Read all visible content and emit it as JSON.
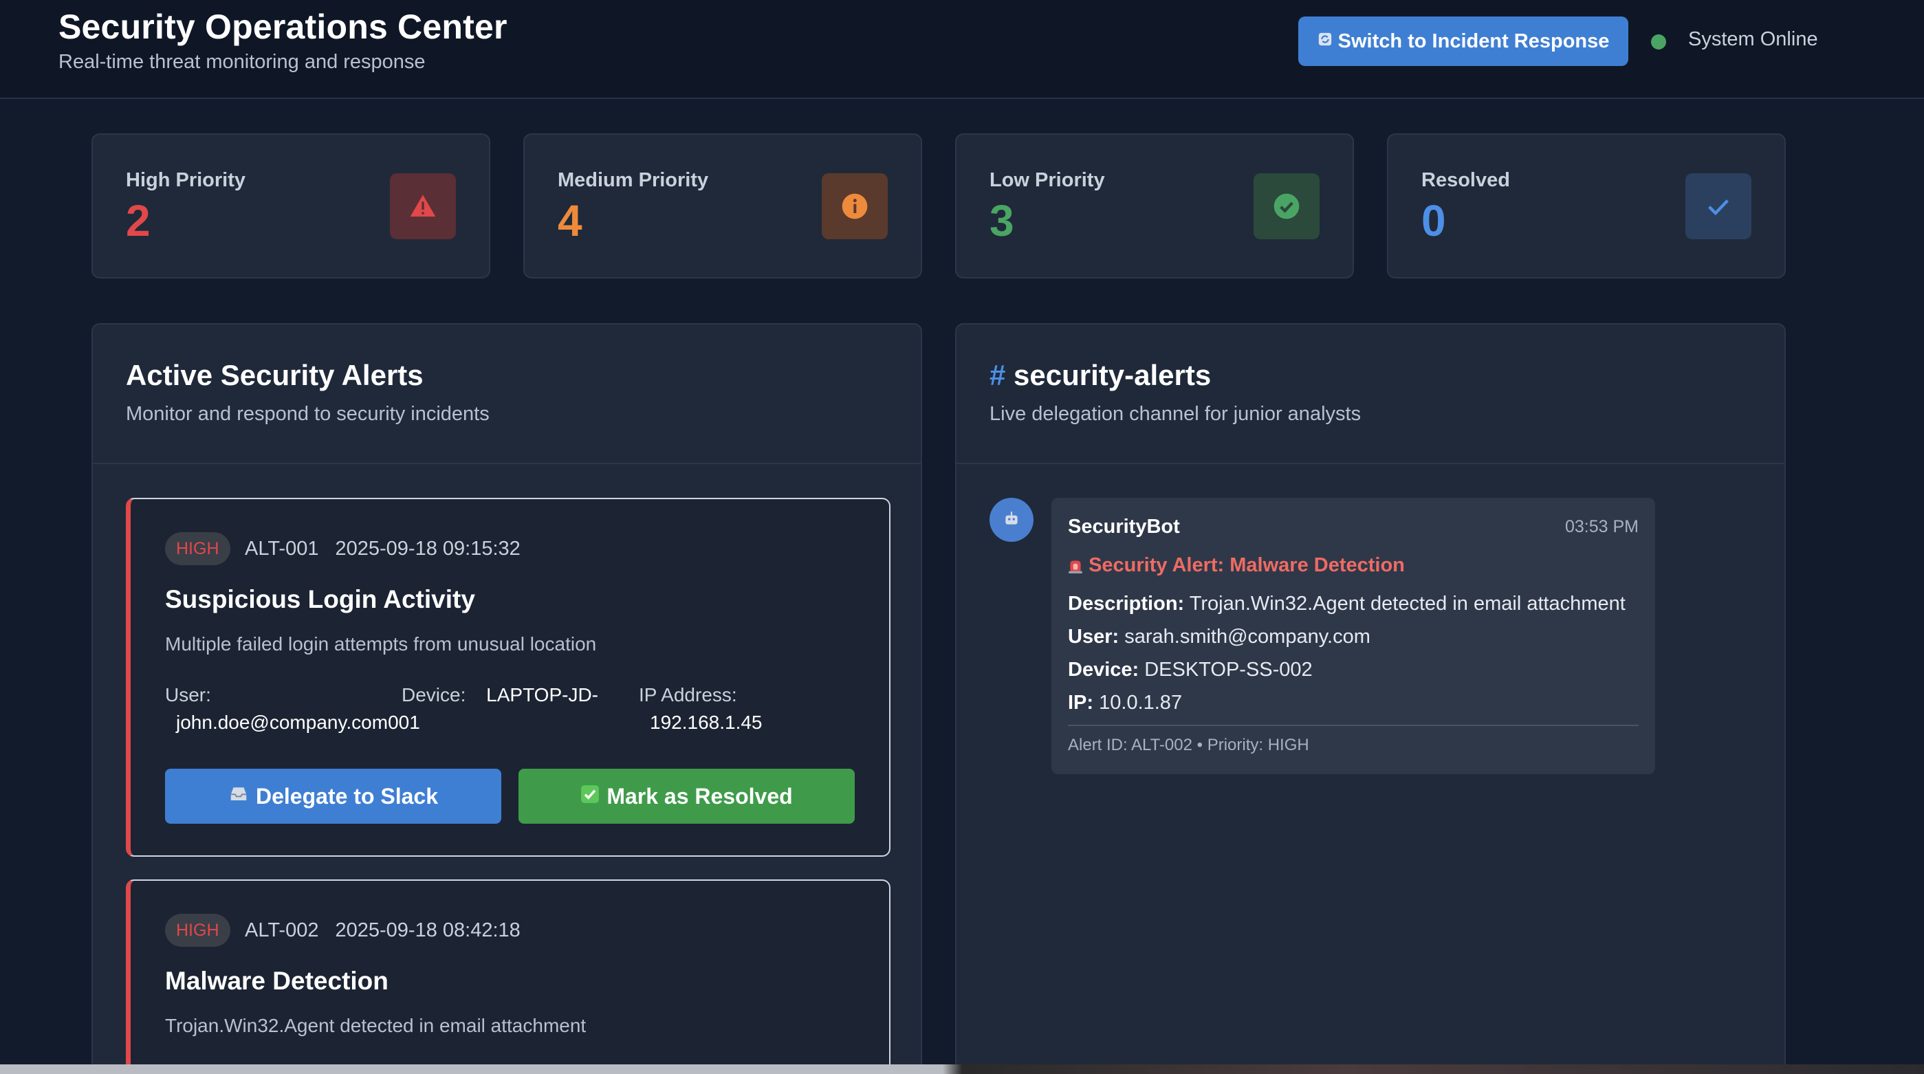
{
  "header": {
    "title": "Security Operations Center",
    "subtitle": "Real-time threat monitoring and response",
    "switch_button": "Switch to Incident Response",
    "switch_icon": "refresh-icon",
    "status": "System Online"
  },
  "stats": [
    {
      "label": "High Priority",
      "value": "2",
      "color": "#e0484a",
      "icon": "warning-triangle-icon"
    },
    {
      "label": "Medium Priority",
      "value": "4",
      "color": "#ee8a3c",
      "icon": "info-circle-icon"
    },
    {
      "label": "Low Priority",
      "value": "3",
      "color": "#4aa564",
      "icon": "check-circle-icon"
    },
    {
      "label": "Resolved",
      "value": "0",
      "color": "#4d8fe6",
      "icon": "checkmark-icon"
    }
  ],
  "alerts_panel": {
    "title": "Active Security Alerts",
    "subtitle": "Monitor and respond to security incidents",
    "alerts": [
      {
        "priority": "HIGH",
        "id": "ALT-001",
        "timestamp": "2025-09-18 09:15:32",
        "title": "Suspicious Login Activity",
        "description": "Multiple failed login attempts from unusual location",
        "user_label": "User:",
        "user": "john.doe@company.com",
        "device_label": "Device:",
        "device_line1": "LAPTOP-JD-",
        "device_line2": "001",
        "ip_label": "IP Address:",
        "ip": "192.168.1.45",
        "delegate_label": "Delegate to Slack",
        "resolve_label": "Mark as Resolved"
      },
      {
        "priority": "HIGH",
        "id": "ALT-002",
        "timestamp": "2025-09-18 08:42:18",
        "title": "Malware Detection",
        "description": "Trojan.Win32.Agent detected in email attachment"
      }
    ]
  },
  "channel_panel": {
    "hash": "#",
    "title": "security-alerts",
    "subtitle": "Live delegation channel for junior analysts",
    "message": {
      "author": "SecurityBot",
      "time": "03:53 PM",
      "alert_title": "Security Alert: Malware Detection",
      "description_label": "Description:",
      "description": "Trojan.Win32.Agent detected in email attachment",
      "user_label": "User:",
      "user": "sarah.smith@company.com",
      "device_label": "Device:",
      "device": "DESKTOP-SS-002",
      "ip_label": "IP:",
      "ip": "10.0.1.87",
      "footer": "Alert ID: ALT-002 • Priority: HIGH"
    }
  }
}
